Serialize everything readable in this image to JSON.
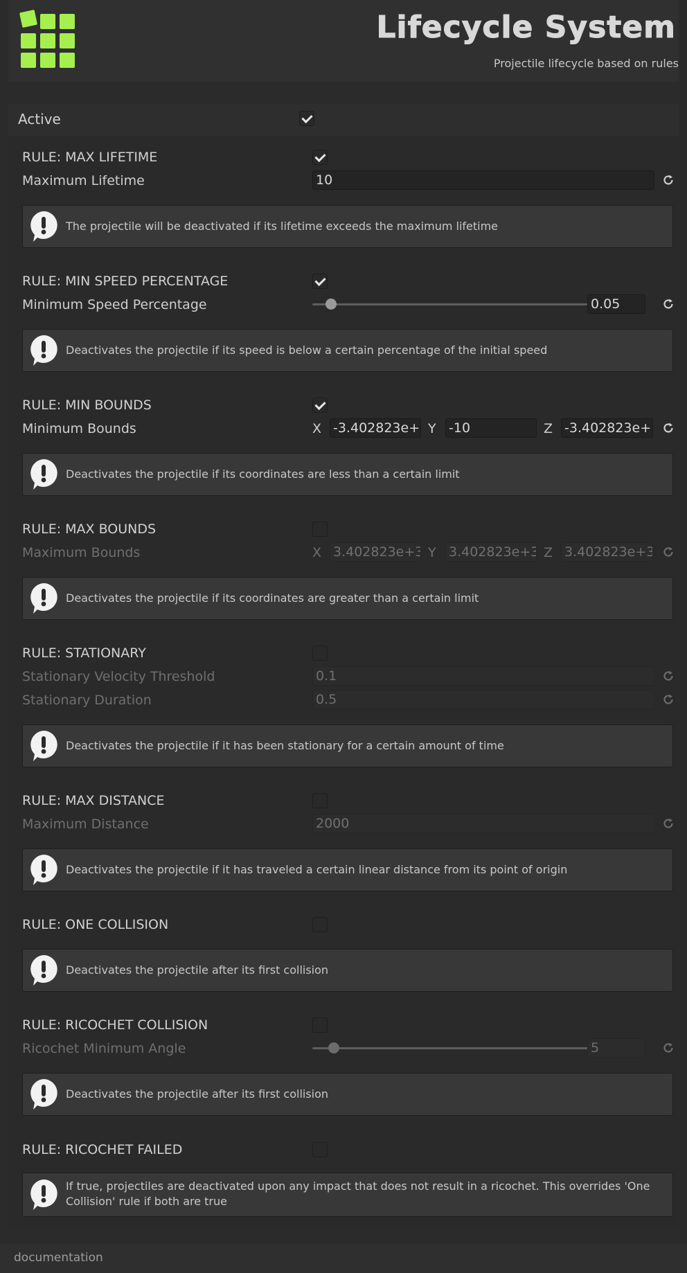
{
  "header": {
    "title": "Lifecycle System",
    "subtitle": "Projectile lifecycle based on rules",
    "logo_color": "#a5f04e"
  },
  "active": {
    "label": "Active",
    "checked": true
  },
  "rules": {
    "max_lifetime": {
      "label": "RULE: MAX LIFETIME",
      "enabled": true,
      "field_label": "Maximum Lifetime",
      "value": "10",
      "help": "The projectile will be deactivated if its lifetime exceeds the maximum lifetime"
    },
    "min_speed": {
      "label": "RULE: MIN SPEED PERCENTAGE",
      "enabled": true,
      "field_label": "Minimum Speed Percentage",
      "value": "0.05",
      "slider_fraction": 0.05,
      "help": "Deactivates the projectile if its speed is below a certain percentage of the initial speed"
    },
    "min_bounds": {
      "label": "RULE: MIN BOUNDS",
      "enabled": true,
      "field_label": "Minimum Bounds",
      "x_label": "X",
      "x": "-3.402823e+",
      "y_label": "Y",
      "y": "-10",
      "z_label": "Z",
      "z": "-3.402823e+",
      "help": "Deactivates the projectile if its coordinates are less than a certain limit"
    },
    "max_bounds": {
      "label": "RULE: MAX BOUNDS",
      "enabled": false,
      "field_label": "Maximum Bounds",
      "x_label": "X",
      "x": "3.402823e+3",
      "y_label": "Y",
      "y": "3.402823e+3",
      "z_label": "Z",
      "z": "3.402823e+3",
      "help": "Deactivates the projectile if its coordinates are greater than a certain limit"
    },
    "stationary": {
      "label": "RULE: STATIONARY",
      "enabled": false,
      "velocity_label": "Stationary Velocity Threshold",
      "velocity": "0.1",
      "duration_label": "Stationary Duration",
      "duration": "0.5",
      "help": "Deactivates the projectile if it has been stationary for a certain amount of time"
    },
    "max_distance": {
      "label": "RULE: MAX DISTANCE",
      "enabled": false,
      "field_label": "Maximum Distance",
      "value": "2000",
      "help": "Deactivates the projectile if it has traveled a certain linear distance from its point of origin"
    },
    "one_collision": {
      "label": "RULE: ONE COLLISION",
      "enabled": false,
      "help": "Deactivates the projectile after its first collision"
    },
    "ricochet_collision": {
      "label": "RULE: RICOCHET COLLISION",
      "enabled": false,
      "field_label": "Ricochet Minimum Angle",
      "value": "5",
      "slider_fraction": 0.06,
      "help": "Deactivates the projectile after its first collision"
    },
    "ricochet_failed": {
      "label": "RULE: RICOCHET FAILED",
      "enabled": false,
      "help_line1": "If true, projectiles are deactivated upon any impact that does not result in a ricochet. This overrides 'One",
      "help_line2": "Collision' rule if both are true"
    }
  },
  "footer": {
    "label": "documentation"
  },
  "icons": {
    "reset": "reset-icon",
    "help": "info-bubble-icon",
    "check": "checkmark-icon"
  }
}
